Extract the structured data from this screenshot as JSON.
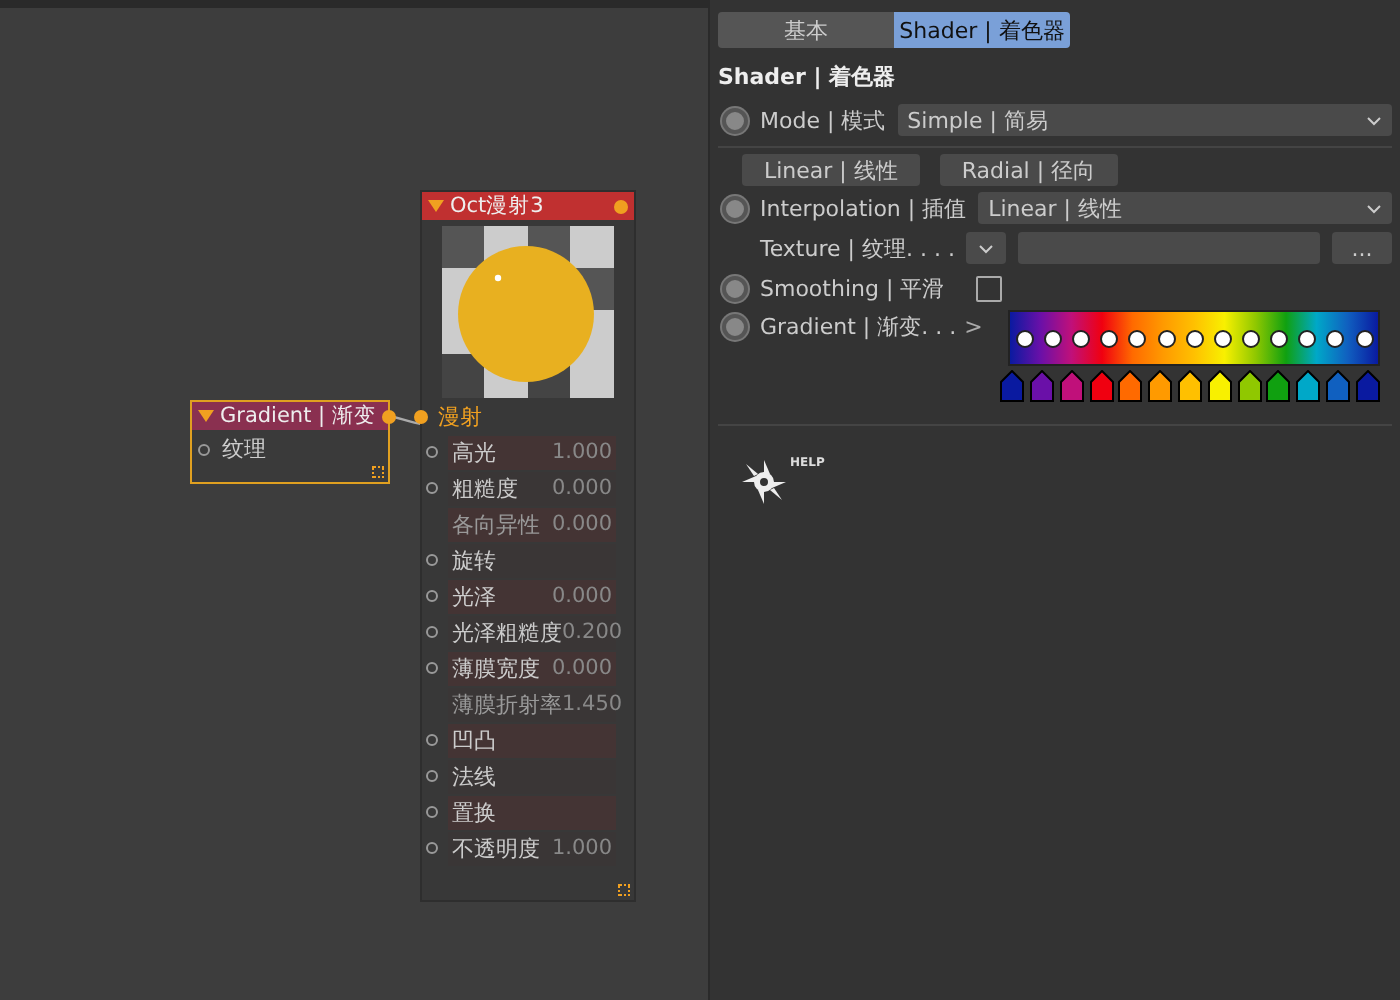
{
  "canvas": {
    "gradient_node": {
      "title": "Gradient | 渐变",
      "inputs": [
        {
          "label": "纹理"
        }
      ]
    },
    "material_node": {
      "title": "Oct漫射3",
      "output_label": "漫射",
      "params": [
        {
          "label": "高光",
          "value": "1.000",
          "port": true
        },
        {
          "label": "粗糙度",
          "value": "0.000",
          "port": true
        },
        {
          "label": "各向异性",
          "value": "0.000",
          "port": false
        },
        {
          "label": "旋转",
          "port": true
        },
        {
          "label": "光泽",
          "value": "0.000",
          "port": true
        },
        {
          "label": "光泽粗糙度",
          "value": "0.200",
          "port": true
        },
        {
          "label": "薄膜宽度",
          "value": "0.000",
          "port": true
        },
        {
          "label": "薄膜折射率",
          "value": "1.450",
          "port": false
        },
        {
          "label": "凹凸",
          "port": true
        },
        {
          "label": "法线",
          "port": true
        },
        {
          "label": "置换",
          "port": true
        },
        {
          "label": "不透明度",
          "value": "1.000",
          "port": true
        }
      ]
    }
  },
  "panel": {
    "tabs": [
      {
        "label": "基本",
        "selected": false
      },
      {
        "label": "Shader | 着色器",
        "selected": true
      }
    ],
    "section_title": "Shader | 着色器",
    "mode": {
      "label": "Mode | 模式",
      "value": "Simple | 简易"
    },
    "buttons": [
      "Linear | 线性",
      "Radial | 径向"
    ],
    "interpolation": {
      "label": "Interpolation | 插值",
      "value": "Linear | 线性"
    },
    "texture": {
      "label": "Texture | 纹理. . . .",
      "browse": "..."
    },
    "smoothing": {
      "label": "Smoothing | 平滑",
      "checked": false
    },
    "gradient": {
      "label": "Gradient | 渐变. . .",
      "expander": ">",
      "knots": [
        {
          "color": "#0a1aa0"
        },
        {
          "color": "#6a10a8"
        },
        {
          "color": "#c0107a"
        },
        {
          "color": "#f00010"
        },
        {
          "color": "#ff6a00"
        },
        {
          "color": "#ff9a00"
        },
        {
          "color": "#ffc000"
        },
        {
          "color": "#f8f000"
        },
        {
          "color": "#90c800"
        },
        {
          "color": "#10a010"
        },
        {
          "color": "#00a8c8"
        },
        {
          "color": "#1060c0"
        },
        {
          "color": "#0a1aa0"
        }
      ]
    },
    "help": {
      "label": "HELP"
    }
  }
}
